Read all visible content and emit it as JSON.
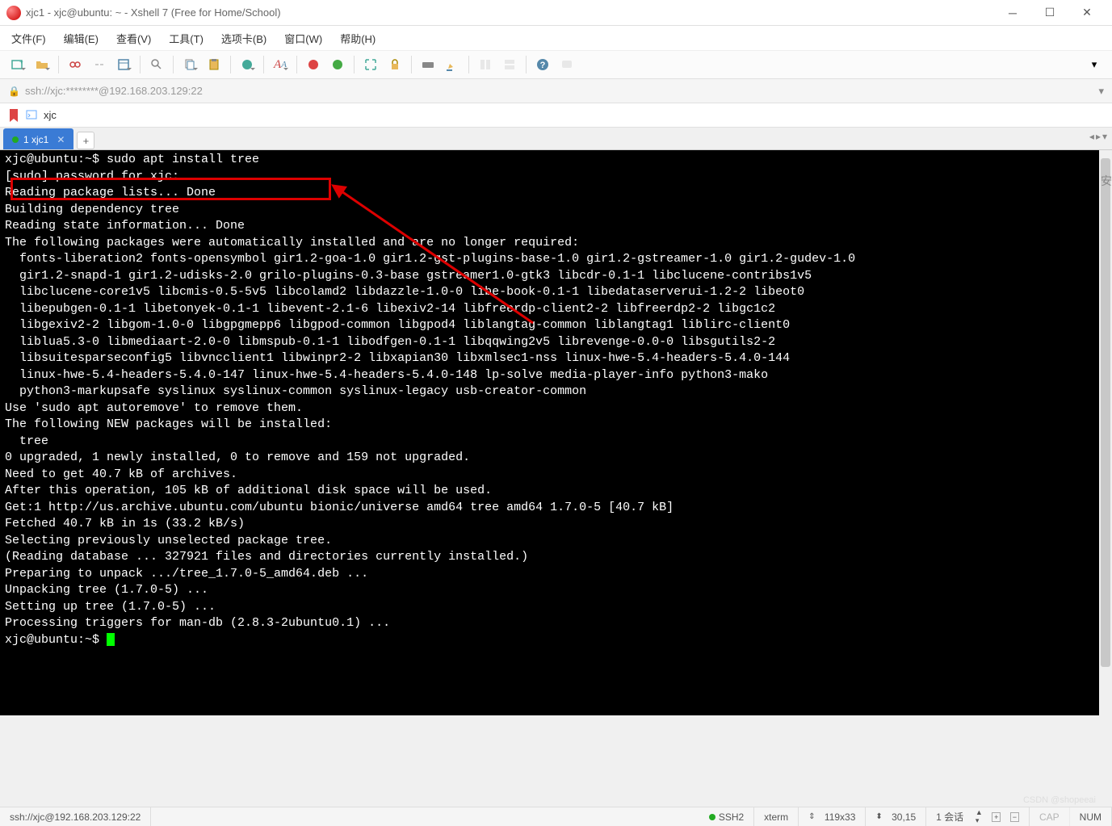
{
  "window": {
    "title": "xjc1 - xjc@ubuntu: ~ - Xshell 7 (Free for Home/School)"
  },
  "menu": {
    "file": "文件(F)",
    "edit": "编辑(E)",
    "view": "查看(V)",
    "tools": "工具(T)",
    "tabs": "选项卡(B)",
    "window": "窗口(W)",
    "help": "帮助(H)"
  },
  "address": {
    "url": "ssh://xjc:********@192.168.203.129:22"
  },
  "session": {
    "name": "xjc"
  },
  "tab": {
    "label": "1 xjc1"
  },
  "highlight": {
    "prompt": "xjc@ubuntu:~$ ",
    "cmd": "sudo apt install tree"
  },
  "term_lines": [
    "[sudo] password for xjc:",
    "Reading package lists... Done",
    "Building dependency tree",
    "Reading state information... Done",
    "The following packages were automatically installed and are no longer required:",
    "  fonts-liberation2 fonts-opensymbol gir1.2-goa-1.0 gir1.2-gst-plugins-base-1.0 gir1.2-gstreamer-1.0 gir1.2-gudev-1.0",
    "  gir1.2-snapd-1 gir1.2-udisks-2.0 grilo-plugins-0.3-base gstreamer1.0-gtk3 libcdr-0.1-1 libclucene-contribs1v5",
    "  libclucene-core1v5 libcmis-0.5-5v5 libcolamd2 libdazzle-1.0-0 libe-book-0.1-1 libedataserverui-1.2-2 libeot0",
    "  libepubgen-0.1-1 libetonyek-0.1-1 libevent-2.1-6 libexiv2-14 libfreerdp-client2-2 libfreerdp2-2 libgc1c2",
    "  libgexiv2-2 libgom-1.0-0 libgpgmepp6 libgpod-common libgpod4 liblangtag-common liblangtag1 liblirc-client0",
    "  liblua5.3-0 libmediaart-2.0-0 libmspub-0.1-1 libodfgen-0.1-1 libqqwing2v5 librevenge-0.0-0 libsgutils2-2",
    "  libsuitesparseconfig5 libvncclient1 libwinpr2-2 libxapian30 libxmlsec1-nss linux-hwe-5.4-headers-5.4.0-144",
    "  linux-hwe-5.4-headers-5.4.0-147 linux-hwe-5.4-headers-5.4.0-148 lp-solve media-player-info python3-mako",
    "  python3-markupsafe syslinux syslinux-common syslinux-legacy usb-creator-common",
    "Use 'sudo apt autoremove' to remove them.",
    "The following NEW packages will be installed:",
    "  tree",
    "0 upgraded, 1 newly installed, 0 to remove and 159 not upgraded.",
    "Need to get 40.7 kB of archives.",
    "After this operation, 105 kB of additional disk space will be used.",
    "Get:1 http://us.archive.ubuntu.com/ubuntu bionic/universe amd64 tree amd64 1.7.0-5 [40.7 kB]",
    "Fetched 40.7 kB in 1s (33.2 kB/s)",
    "Selecting previously unselected package tree.",
    "(Reading database ... 327921 files and directories currently installed.)",
    "Preparing to unpack .../tree_1.7.0-5_amd64.deb ...",
    "Unpacking tree (1.7.0-5) ...",
    "Setting up tree (1.7.0-5) ...",
    "Processing triggers for man-db (2.8.3-2ubuntu0.1) ..."
  ],
  "final_prompt": "xjc@ubuntu:~$ ",
  "status": {
    "addr": "ssh://xjc@192.168.203.129:22",
    "proto": "SSH2",
    "term": "xterm",
    "size": "119x33",
    "cursor": "30,15",
    "sessions": "1 会话",
    "cap": "CAP",
    "num": "NUM"
  },
  "watermark": "CSDN @shopeeai",
  "side": "安"
}
